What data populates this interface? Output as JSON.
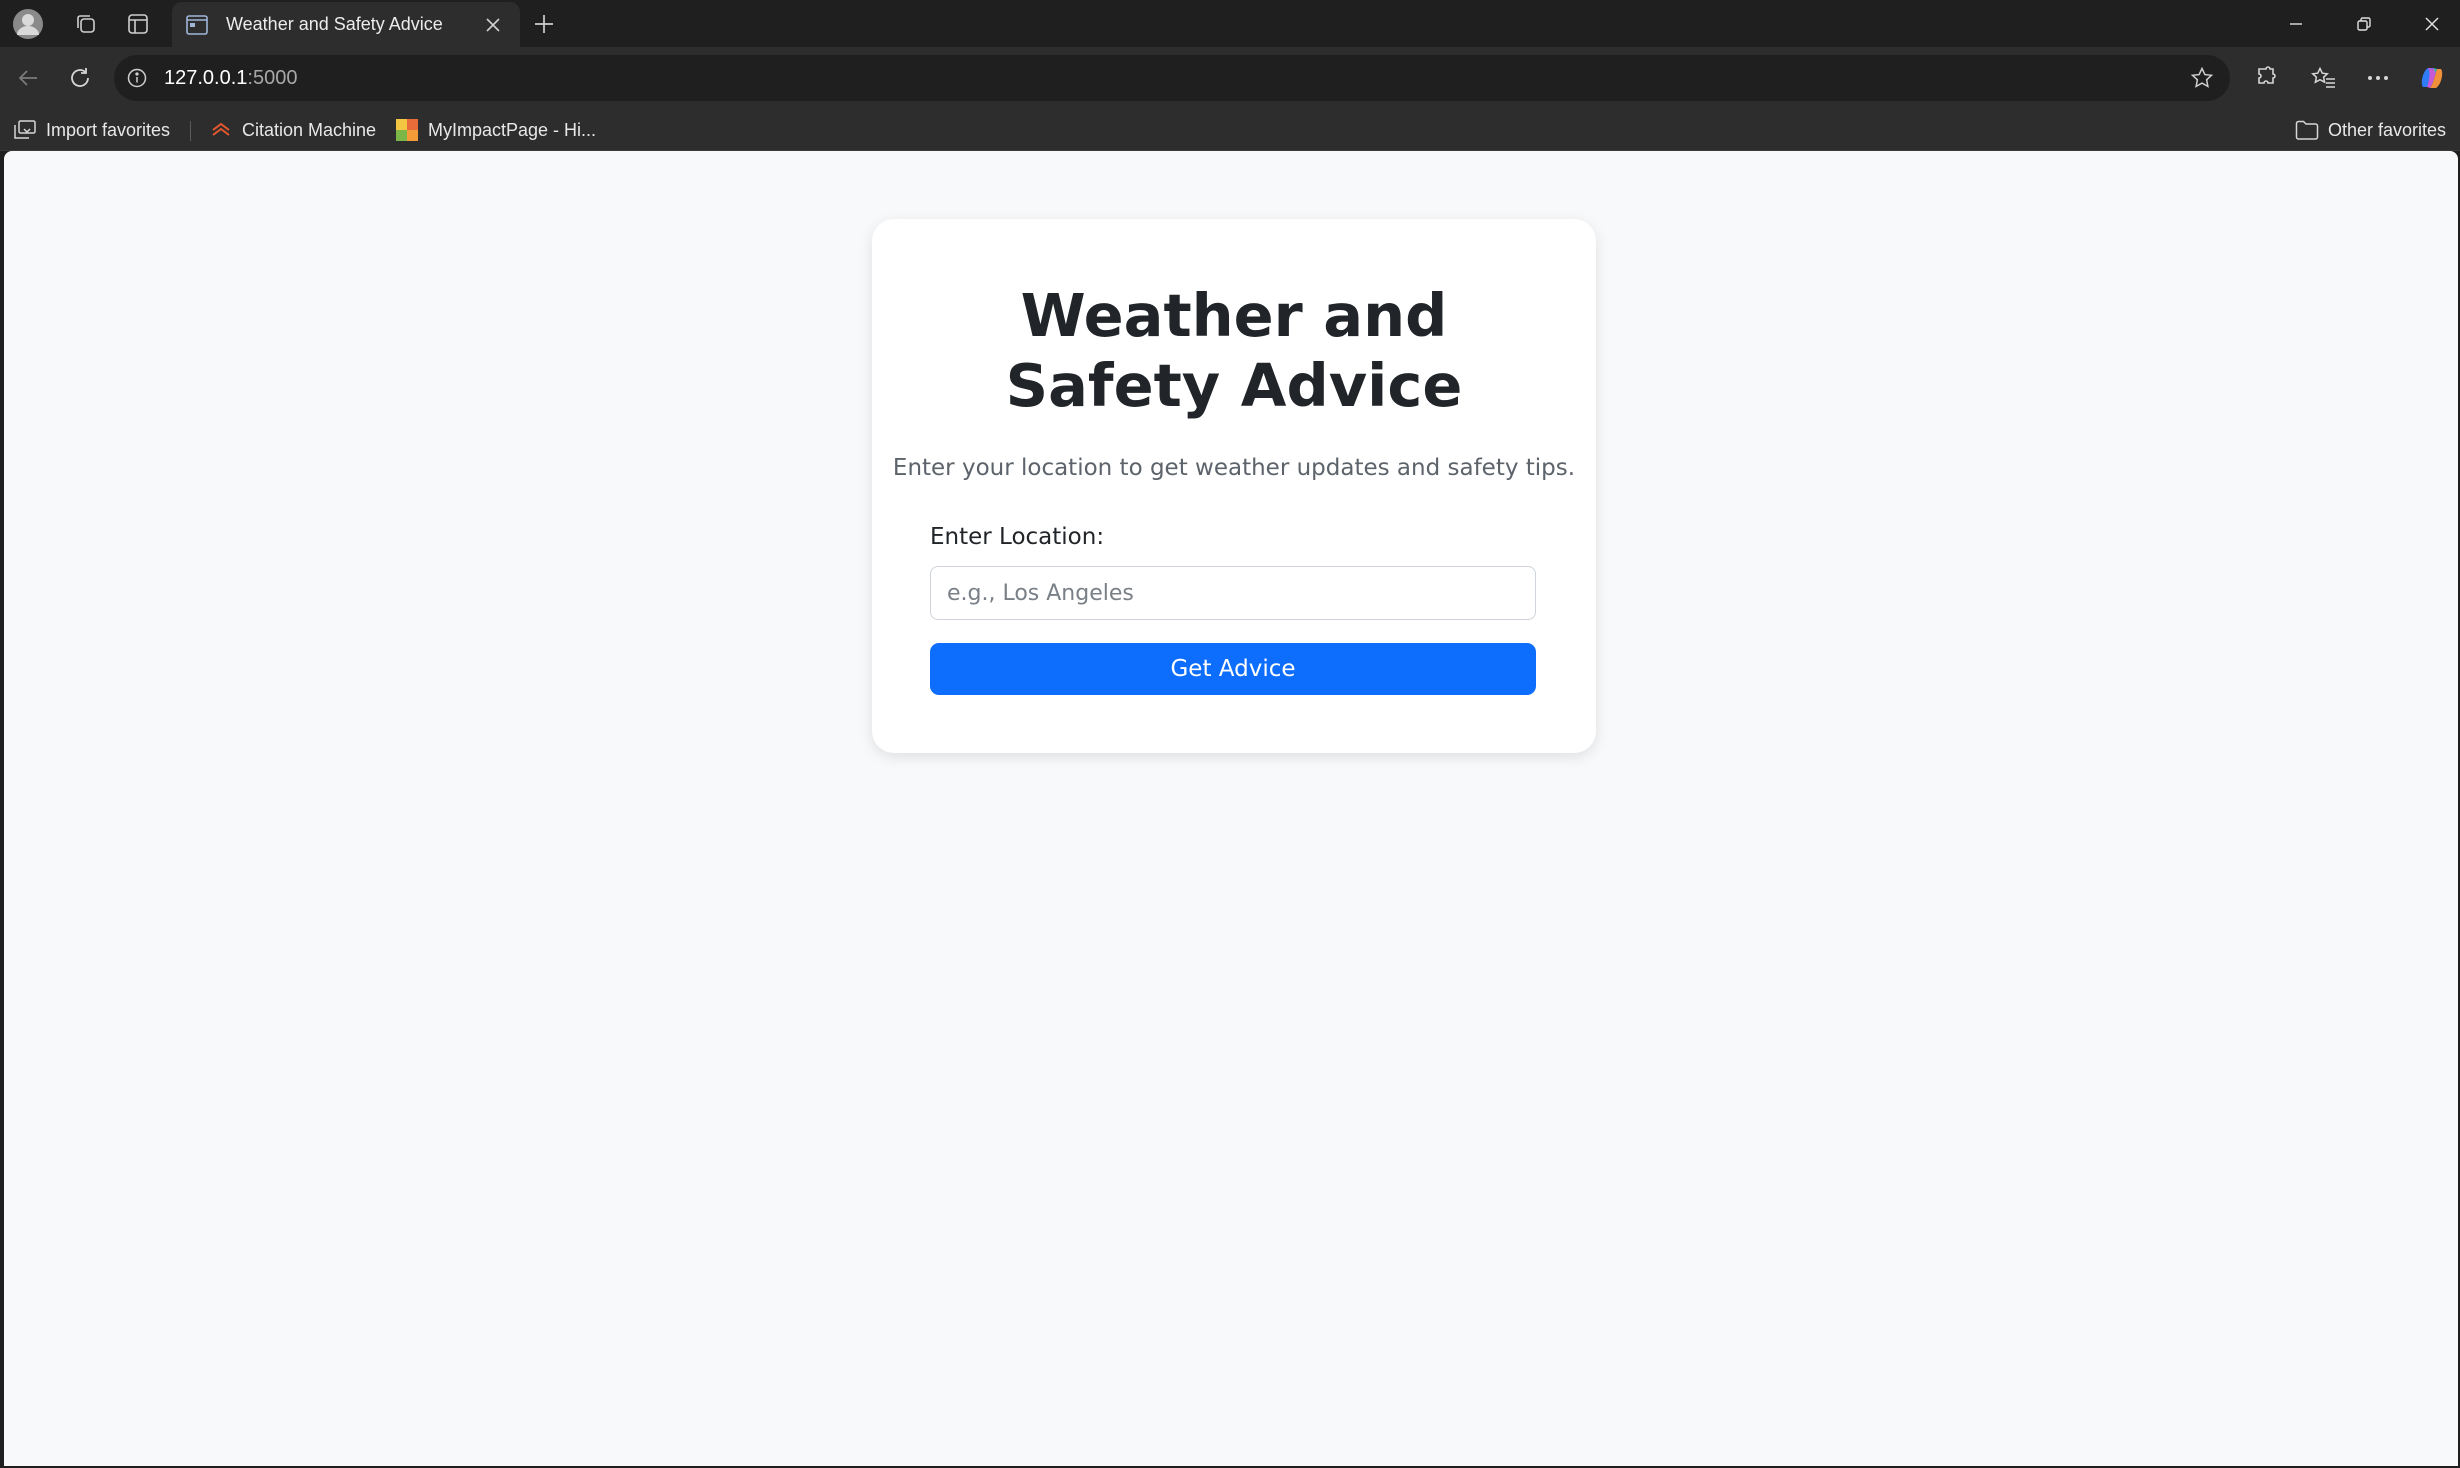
{
  "browser": {
    "tab": {
      "title": "Weather and Safety Advice"
    },
    "address_bar": {
      "host": "127.0.0.1",
      "port": ":5000"
    },
    "bookmarks": [
      {
        "label": "Import favorites",
        "icon": "import-icon"
      },
      {
        "label": "Citation Machine",
        "icon": "citation-machine-favicon"
      },
      {
        "label": "MyImpactPage - Hi...",
        "icon": "myimpactpage-favicon"
      }
    ],
    "other_favorites": "Other favorites"
  },
  "page": {
    "title": "Weather and Safety Advice",
    "subtitle": "Enter your location to get weather updates and safety tips.",
    "location_label": "Enter Location:",
    "location_value": "",
    "location_placeholder": "e.g., Los Angeles",
    "submit_label": "Get Advice"
  },
  "colors": {
    "page_bg": "#f8f9fa",
    "primary_button": "#0d6efd",
    "browser_chrome": "#1f1f1f"
  }
}
